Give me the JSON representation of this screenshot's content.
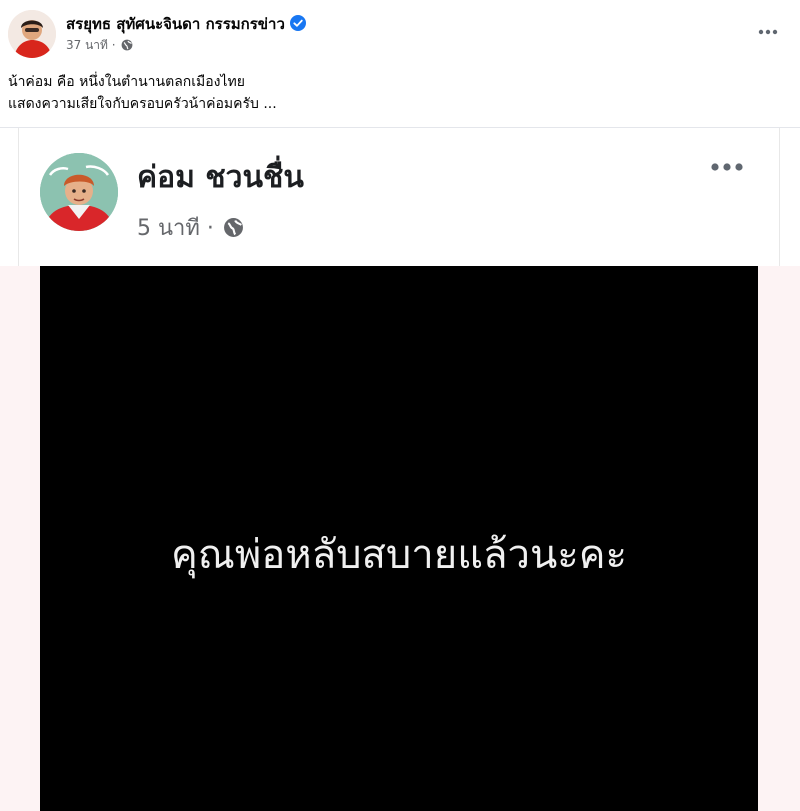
{
  "outer_post": {
    "author_name": "สรยุทธ สุทัศนะจินดา กรรมกรข่าว",
    "time": "37 นาที",
    "separator": "·",
    "text_line1": "น้าค่อม คือ หนึ่งในตำนานตลกเมืองไทย",
    "text_line2": "แสดงความเสียใจกับครอบครัวน้าค่อมครับ ..."
  },
  "shared_post": {
    "author_name": "ค่อม ชวนชื่น",
    "time": "5 นาที",
    "separator": "·",
    "image_text": "คุณพ่อหลับสบายแล้วนะคะ"
  },
  "icons": {
    "verified": "verified-badge-icon",
    "privacy": "globe-icon",
    "more": "more-options-icon"
  },
  "colors": {
    "verified_blue": "#1877f2",
    "meta_gray": "#65676b",
    "image_background": "#000000",
    "band_pink": "#fdf3f4"
  }
}
